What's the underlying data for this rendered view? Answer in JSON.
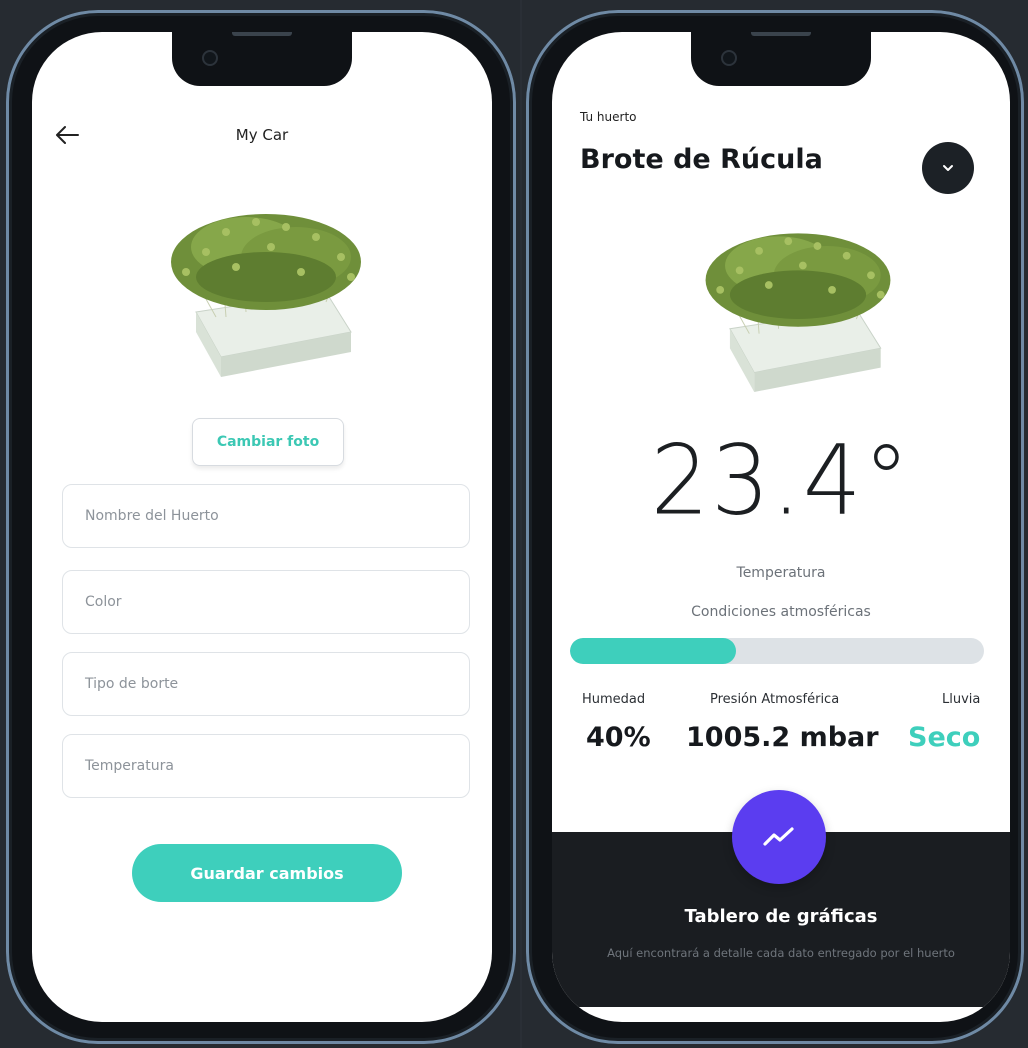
{
  "edit_screen": {
    "title": "My Car",
    "change_photo_label": "Cambiar foto",
    "fields": [
      {
        "placeholder": "Nombre del Huerto"
      },
      {
        "placeholder": "Color"
      },
      {
        "placeholder": "Tipo de borte"
      },
      {
        "placeholder": "Temperatura"
      }
    ],
    "save_label": "Guardar cambios"
  },
  "detail_screen": {
    "eyebrow": "Tu huerto",
    "plant_name": "Brote de Rúcula",
    "temperature_value": "23.4°",
    "temperature_label": "Temperatura",
    "conditions_label": "Condiciones atmosféricas",
    "humidity_progress_pct": 40,
    "stats": {
      "humidity_label": "Humedad",
      "humidity_value": "40%",
      "pressure_label": "Presión Atmosférica",
      "pressure_value": "1005.2 mbar",
      "rain_label": "Lluvia",
      "rain_value": "Seco"
    },
    "dashboard_title": "Tablero de gráficas",
    "dashboard_description": "Aquí encontrará a detalle cada dato entregado por el huerto"
  },
  "colors": {
    "accent": "#3ecfbc",
    "fab": "#5b3df0",
    "dark": "#1a1d21"
  },
  "icons": [
    "back-arrow-icon",
    "chevron-down-icon",
    "trending-up-icon",
    "camera-icon"
  ]
}
